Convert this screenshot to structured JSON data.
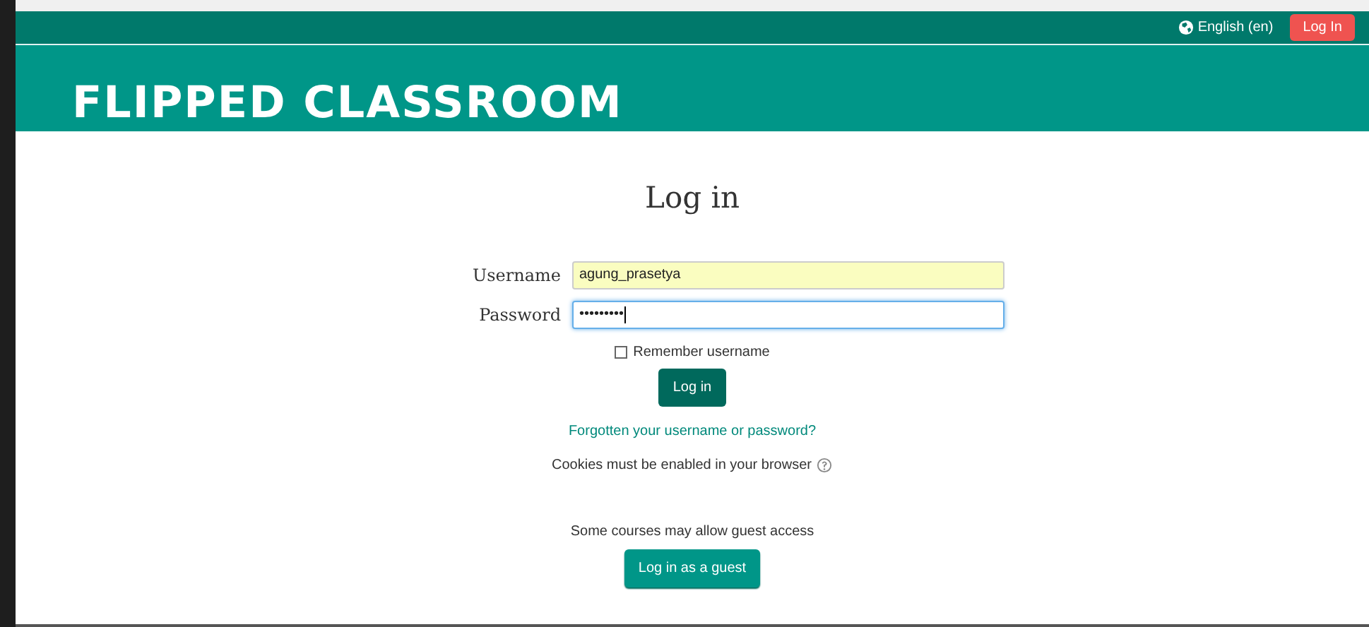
{
  "navbar": {
    "language": "English (en)",
    "login_button": "Log In"
  },
  "header": {
    "title": "FLIPPED CLASSROOM"
  },
  "login": {
    "heading": "Log in",
    "fields": [
      {
        "label": "Username",
        "value": "agung_prasetya",
        "autofilled": true,
        "focused": false
      },
      {
        "label": "Password",
        "value": "•••••••••",
        "autofilled": false,
        "focused": true
      }
    ],
    "remember": {
      "label": "Remember username",
      "checked": false
    },
    "submit": "Log in",
    "forgot_link": "Forgotten your username or password?",
    "cookies_note": "Cookies must be enabled in your browser",
    "guest_note": "Some courses may allow guest access",
    "guest_button": "Log in as a guest"
  }
}
